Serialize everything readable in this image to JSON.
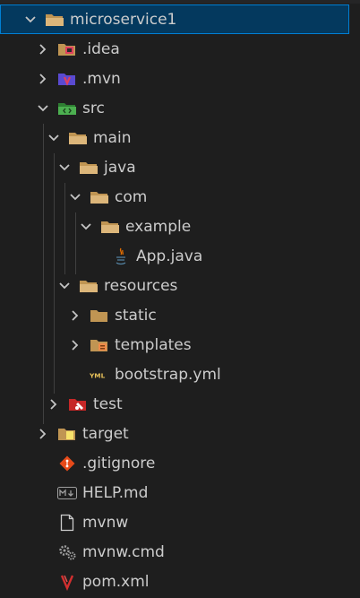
{
  "explorer": {
    "items": [
      {
        "name": "microservice1",
        "kind": "folder-open",
        "expanded": true
      },
      {
        "name": ".idea",
        "kind": "folder-idea",
        "expanded": false
      },
      {
        "name": ".mvn",
        "kind": "folder-mvn",
        "expanded": false
      },
      {
        "name": "src",
        "kind": "folder-src",
        "expanded": true
      },
      {
        "name": "main",
        "kind": "folder-open",
        "expanded": true
      },
      {
        "name": "java",
        "kind": "folder-open",
        "expanded": true
      },
      {
        "name": "com",
        "kind": "folder-open",
        "expanded": true
      },
      {
        "name": "example",
        "kind": "folder-open",
        "expanded": true
      },
      {
        "name": "App.java",
        "kind": "file-java"
      },
      {
        "name": "resources",
        "kind": "folder-open",
        "expanded": true
      },
      {
        "name": "static",
        "kind": "folder",
        "expanded": false
      },
      {
        "name": "templates",
        "kind": "folder-templates",
        "expanded": false
      },
      {
        "name": "bootstrap.yml",
        "kind": "file-yml"
      },
      {
        "name": "test",
        "kind": "folder-test",
        "expanded": false
      },
      {
        "name": "target",
        "kind": "folder-target",
        "expanded": false
      },
      {
        "name": ".gitignore",
        "kind": "file-git"
      },
      {
        "name": "HELP.md",
        "kind": "file-markdown"
      },
      {
        "name": "mvnw",
        "kind": "file-blank"
      },
      {
        "name": "mvnw.cmd",
        "kind": "file-cmd"
      },
      {
        "name": "pom.xml",
        "kind": "file-maven"
      }
    ]
  },
  "colors": {
    "background": "#1e1e1e",
    "selection": "#04395e",
    "selection_border": "#007fd4",
    "text": "#cccccc",
    "folder": "#c09553",
    "chevron": "#c5c5c5"
  }
}
